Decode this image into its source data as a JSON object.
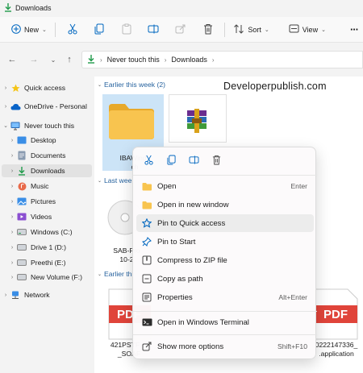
{
  "window": {
    "title": "Downloads"
  },
  "toolbar": {
    "new_label": "New",
    "sort_label": "Sort",
    "view_label": "View",
    "more": "···"
  },
  "address": {
    "path": [
      "Never touch this",
      "Downloads"
    ]
  },
  "sidebar": {
    "items": [
      {
        "label": "Quick access",
        "icon": "star-icon"
      },
      {
        "label": "OneDrive - Personal",
        "icon": "cloud-icon"
      },
      {
        "label": "Never touch this",
        "icon": "monitor-icon"
      },
      {
        "label": "Desktop",
        "icon": "desktop-icon"
      },
      {
        "label": "Documents",
        "icon": "documents-icon"
      },
      {
        "label": "Downloads",
        "icon": "download-icon"
      },
      {
        "label": "Music",
        "icon": "music-icon"
      },
      {
        "label": "Pictures",
        "icon": "pictures-icon"
      },
      {
        "label": "Videos",
        "icon": "videos-icon"
      },
      {
        "label": "Windows (C:)",
        "icon": "drive-icon"
      },
      {
        "label": "Drive 1 (D:)",
        "icon": "drive-icon"
      },
      {
        "label": "Preethi (E:)",
        "icon": "drive-icon"
      },
      {
        "label": "New Volume (F:)",
        "icon": "drive-icon"
      },
      {
        "label": "Network",
        "icon": "network-icon"
      }
    ]
  },
  "content": {
    "groups": [
      "Earlier this week (2)",
      "Last wee",
      "Earlier thi"
    ],
    "files": {
      "folder_line1": "IBAWind",
      "folder_line2": "ch",
      "sab_line1": "SAB-Pro",
      "sab_line2": "10-2",
      "pdf1_line1": "421PSTF",
      "pdf1_line2": "_SOAF",
      "pdf2_line1": "0222147336_",
      "pdf2_line2": ".application",
      "pdf_tag": "PDF"
    },
    "watermark": "Developerpublish.com"
  },
  "context_menu": {
    "items": [
      {
        "label": "Open",
        "shortcut": "Enter"
      },
      {
        "label": "Open in new window",
        "shortcut": ""
      },
      {
        "label": "Pin to Quick access",
        "shortcut": ""
      },
      {
        "label": "Pin to Start",
        "shortcut": ""
      },
      {
        "label": "Compress to ZIP file",
        "shortcut": ""
      },
      {
        "label": "Copy as path",
        "shortcut": ""
      },
      {
        "label": "Properties",
        "shortcut": "Alt+Enter"
      },
      {
        "label": "Open in Windows Terminal",
        "shortcut": ""
      },
      {
        "label": "Show more options",
        "shortcut": "Shift+F10"
      }
    ]
  },
  "colors": {
    "accent": "#0067c0",
    "folder": "#f8c44f",
    "green": "#1f9a4a",
    "pdf_red": "#e0443a",
    "selection": "#cce4f7"
  }
}
